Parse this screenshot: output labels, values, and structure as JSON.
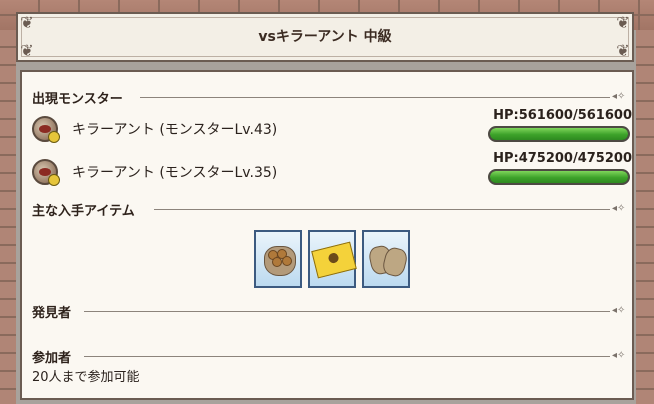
{
  "window": {
    "title": "vsキラーアント 中級"
  },
  "sections": {
    "monsters_heading": "出現モンスター",
    "items_heading": "主な入手アイテム",
    "discoverer_heading": "発見者",
    "participants_heading": "参加者"
  },
  "monsters": [
    {
      "name": "キラーアント (モンスターLv.43)",
      "hp_label": "HP:561600/561600",
      "hp_fraction": 1.0
    },
    {
      "name": "キラーアント (モンスターLv.35)",
      "hp_label": "HP:475200/475200",
      "hp_fraction": 1.0
    }
  ],
  "items": [
    {
      "icon": "nut-sack-icon"
    },
    {
      "icon": "gold-ticket-icon"
    },
    {
      "icon": "cloth-pouch-icon"
    }
  ],
  "participants": {
    "limit_text": "20人まで参加可能"
  },
  "colors": {
    "hp_green": "#3da22a",
    "frame": "#6b5c52",
    "panel_bg": "#fbf8f2"
  }
}
